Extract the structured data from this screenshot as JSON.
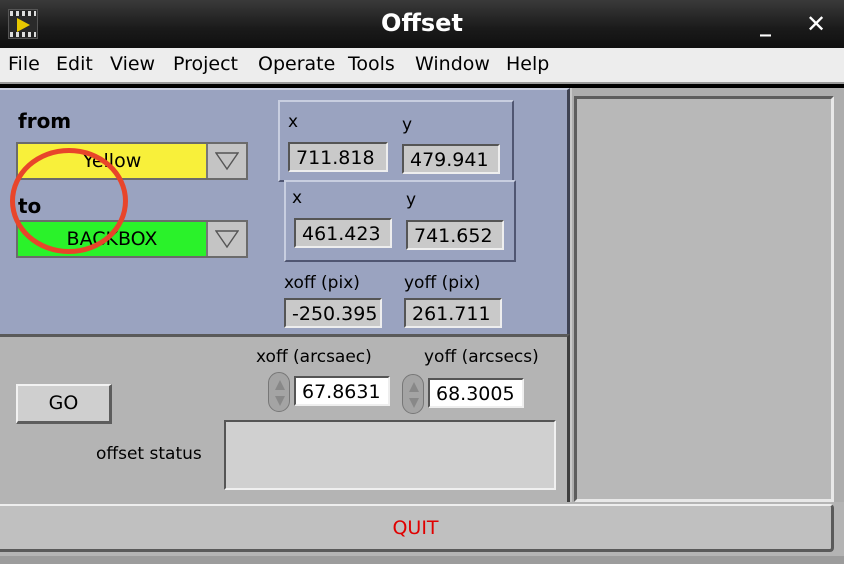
{
  "window": {
    "title": "Offset"
  },
  "titlebar": {
    "minimize_glyph": "_",
    "close_glyph": "✕"
  },
  "menu": [
    "File",
    "Edit",
    "View",
    "Project",
    "Operate",
    "Tools",
    "Window",
    "Help"
  ],
  "top_panel": {
    "from_label": "from",
    "from_value": "Yellow",
    "from_color": "#f8f03a",
    "to_label": "to",
    "to_value": "BACKBOX",
    "to_color": "#2af22a",
    "from_pos": {
      "x_label": "x",
      "y_label": "y",
      "x": "711.818",
      "y": "479.941"
    },
    "to_pos": {
      "x_label": "x",
      "y_label": "y",
      "x": "461.423",
      "y": "741.652"
    },
    "offset_pix": {
      "x_label": "xoff (pix)",
      "y_label": "yoff (pix)",
      "x": "-250.395",
      "y": "261.711"
    }
  },
  "bottom_panel": {
    "xoff_arcsec_label": "xoff (arcsaec)",
    "yoff_arcsec_label": "yoff (arcsecs)",
    "xoff_arcsec": "67.8631",
    "yoff_arcsec": "68.3005",
    "go_label": "GO",
    "status_label": "offset status",
    "status_value": ""
  },
  "quit_label": "QUIT",
  "colors": {
    "accent_quit": "#e00000",
    "annotation": "#e8452a"
  }
}
